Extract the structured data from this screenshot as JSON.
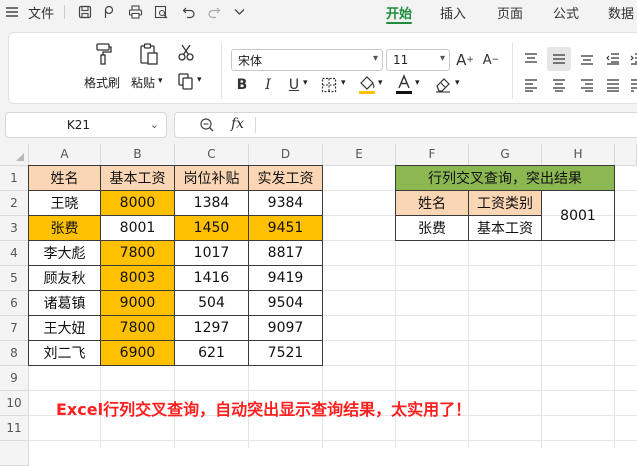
{
  "menu": {
    "file_label": "文件",
    "tabs": [
      "开始",
      "插入",
      "页面",
      "公式",
      "数据"
    ]
  },
  "ribbon": {
    "format_painter_label": "格式刷",
    "paste_label": "粘贴",
    "font_name": "宋体",
    "font_size": "11"
  },
  "formula_bar": {
    "name_box": "K21",
    "fx_label": "fx",
    "formula": ""
  },
  "sheet": {
    "columns": [
      "A",
      "B",
      "C",
      "D",
      "E",
      "F",
      "G",
      "H"
    ],
    "rows": [
      "1",
      "2",
      "3",
      "4",
      "5",
      "6",
      "7",
      "8",
      "9",
      "10",
      "11"
    ],
    "table": {
      "headers": [
        "姓名",
        "基本工资",
        "岗位补贴",
        "实发工资"
      ],
      "rows": [
        [
          "王晓",
          "8000",
          "1384",
          "9384"
        ],
        [
          "张费",
          "8001",
          "1450",
          "9451"
        ],
        [
          "李大彪",
          "7800",
          "1017",
          "8817"
        ],
        [
          "顾友秋",
          "8003",
          "1416",
          "9419"
        ],
        [
          "诸葛镇",
          "9000",
          "504",
          "9504"
        ],
        [
          "王大妞",
          "7800",
          "1297",
          "9097"
        ],
        [
          "刘二飞",
          "6900",
          "621",
          "7521"
        ]
      ]
    },
    "lookup": {
      "title": "行列交叉查询，突出结果",
      "name_header": "姓名",
      "type_header": "工资类别",
      "name_value": "张费",
      "type_value": "基本工资",
      "result": "8001"
    },
    "note": "Excel行列交叉查询，自动突出显示查询结果，太实用了！"
  },
  "colors": {
    "header_fill": "#fbd6b5",
    "highlight_fill": "#ffc000",
    "title_fill": "#8cb852",
    "active_tab": "#1f8c3b",
    "note_text": "#ff1f1f"
  }
}
